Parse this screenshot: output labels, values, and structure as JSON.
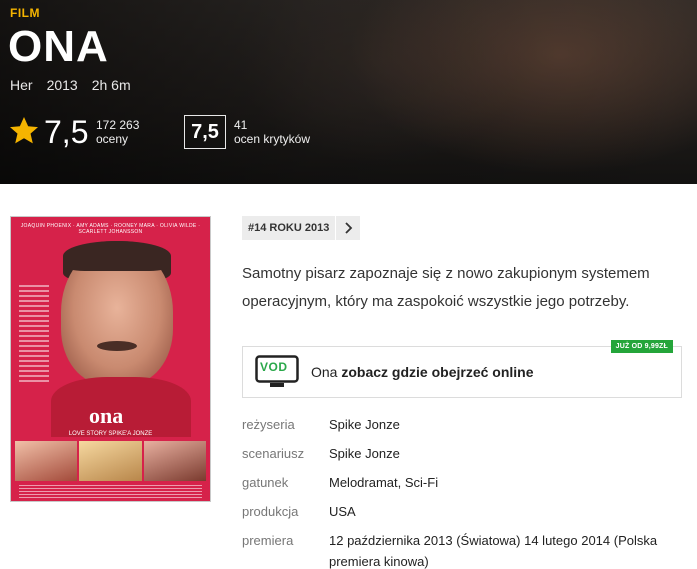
{
  "hero": {
    "category": "FILM",
    "title": "ONA",
    "original_title": "Her",
    "year": "2013",
    "duration": "2h 6m",
    "rating": "7,5",
    "rating_count": "172 263",
    "rating_label": "oceny",
    "critic_rating": "7,5",
    "critic_count": "41",
    "critic_label": "ocen krytyków"
  },
  "poster": {
    "names": "JOAQUIN PHOENIX · AMY ADAMS · ROONEY MARA · OLIVIA WILDE · SCARLETT JOHANSSON",
    "logo": "ona",
    "tagline": "LOVE STORY SPIKE'A JONZE"
  },
  "rank": {
    "label": "#14 ROKU 2013"
  },
  "description": "Samotny pisarz zapoznaje się z nowo zakupionym systemem operacyjnym, który ma zaspokoić wszystkie jego potrzeby.",
  "vod": {
    "icon_text": "VOD",
    "title": "Ona",
    "cta": "zobacz gdzie obejrzeć online",
    "badge": "JUŻ OD 9,99ZŁ"
  },
  "info": [
    {
      "label": "reżyseria",
      "value": "Spike Jonze"
    },
    {
      "label": "scenariusz",
      "value": "Spike Jonze"
    },
    {
      "label": "gatunek",
      "value": "Melodramat, Sci-Fi"
    },
    {
      "label": "produkcja",
      "value": "USA"
    },
    {
      "label": "premiera",
      "value": "12 października 2013 (Światowa) 14 lutego 2014 (Polska premiera kinowa)"
    }
  ],
  "colors": {
    "accent": "#f5b400",
    "badge_green": "#24a53a",
    "vod_green": "#2aa84a",
    "poster_red": "#d6224a"
  },
  "icons": {
    "rating": "star-icon",
    "rank_next": "chevron-right-icon",
    "vod": "tv-icon"
  }
}
